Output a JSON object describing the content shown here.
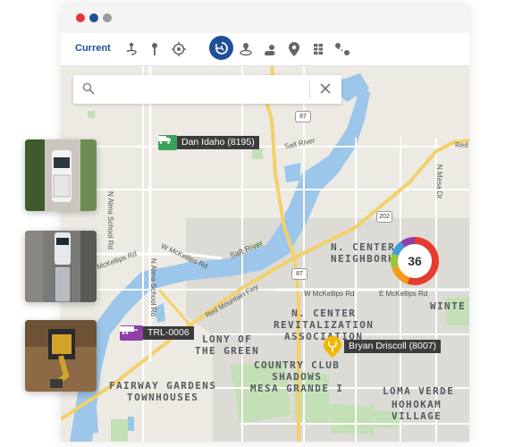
{
  "window": {
    "controls": [
      "close",
      "minimize",
      "maximize"
    ]
  },
  "toolbar": {
    "label": "Current",
    "tools": [
      {
        "icon": "route-icon"
      },
      {
        "icon": "location-pin-icon"
      },
      {
        "icon": "target-icon"
      },
      {
        "icon": "history-icon",
        "active": true
      },
      {
        "icon": "geofence-icon"
      },
      {
        "icon": "weather-icon"
      },
      {
        "icon": "map-marker-icon"
      },
      {
        "icon": "layers-icon"
      },
      {
        "icon": "trip-path-icon"
      }
    ]
  },
  "search": {
    "placeholder": "",
    "value": ""
  },
  "vehicles": [
    {
      "label": "Dan Idaho (8195)",
      "icon": "truck-icon",
      "color": "#3aa35b"
    },
    {
      "label": "TRL-0006",
      "icon": "trailer-icon",
      "color": "#8e3fa8"
    }
  ],
  "driver": {
    "label": "Bryan Driscoll (8007)",
    "icon": "driver-pin-icon",
    "color": "#f0b800"
  },
  "cluster": {
    "count": "36",
    "segments": [
      {
        "color": "#e63b2e",
        "value": 0.55
      },
      {
        "color": "#f39a1e",
        "value": 0.15
      },
      {
        "color": "#9bc43a",
        "value": 0.1
      },
      {
        "color": "#3e9fd8",
        "value": 0.1
      },
      {
        "color": "#8e3fa8",
        "value": 0.1
      }
    ]
  },
  "areas": {
    "n_center_neighborhood": [
      "N. CENTER",
      "NEIGHBORH"
    ],
    "revitalization": [
      "N. CENTER",
      "REVITALIZATION",
      "ASSOCIATION"
    ],
    "colony": [
      "LONY OF",
      "THE GREEN"
    ],
    "country_club": [
      "COUNTRY CLUB",
      "SHADOWS",
      "MESA GRANDE I"
    ],
    "fairway": [
      "FAIRWAY GARDENS",
      "TOWNHOUSES"
    ],
    "loma_verde": "LOMA VERDE",
    "winte": "WINTE",
    "hohokam": [
      "HOHOKAM",
      "VILLAGE"
    ]
  },
  "roads": {
    "mckellips_w": "E McKellips Rd",
    "mckellips_w2": "W McKellips Rd",
    "mckellips_e": "W McKellips Rd",
    "mckellips_e2": "E McKellips Rd",
    "alma_school_1": "N Alma School Rd",
    "alma_school_2": "N Alma School Rd",
    "red_mountain": "Red Mountain Fwy",
    "salt_river": "Salt River",
    "mesa_dr": "N Mesa Dr",
    "red": "Red"
  },
  "shields": {
    "r202": "202",
    "r87a": "87",
    "r87b": "87"
  },
  "thumbnails": [
    {
      "name": "pickup-truck-top-view"
    },
    {
      "name": "semi-truck-top-view"
    },
    {
      "name": "excavator-top-view"
    }
  ]
}
